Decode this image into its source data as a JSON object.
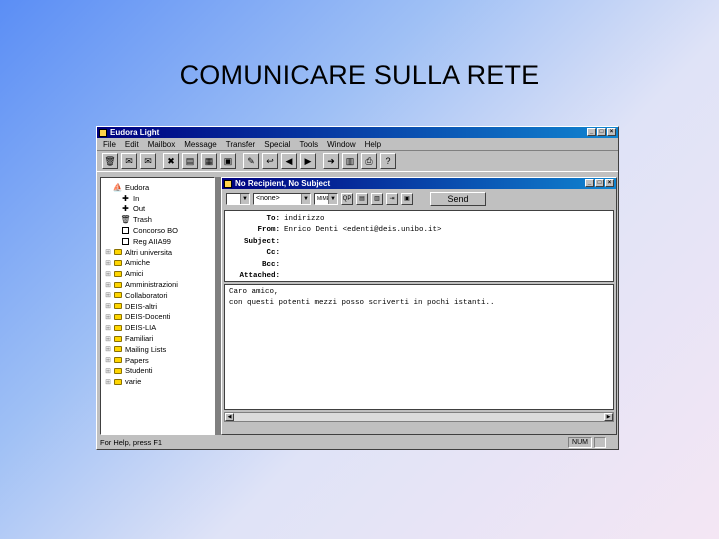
{
  "slide": {
    "title": "COMUNICARE SULLA RETE"
  },
  "app": {
    "title": "Eudora Light",
    "menu": [
      "File",
      "Edit",
      "Mailbox",
      "Message",
      "Transfer",
      "Special",
      "Tools",
      "Window",
      "Help"
    ],
    "status": "For Help, press F1",
    "status_num": "NUM"
  },
  "tree": {
    "items": [
      {
        "label": "Eudora",
        "lead": "",
        "icon": "eudora-icon"
      },
      {
        "label": "In",
        "lead": "",
        "icon": "in-box-icon"
      },
      {
        "label": "Out",
        "lead": "",
        "icon": "out-box-icon"
      },
      {
        "label": "Trash",
        "lead": "",
        "icon": "trash-icon"
      },
      {
        "label": "Concorso BO",
        "lead": "",
        "icon": "mailbox-icon"
      },
      {
        "label": "Reg AIIA99",
        "lead": "",
        "icon": "mailbox-icon"
      },
      {
        "label": "Altri universita",
        "lead": "⊞",
        "icon": "folder-icon"
      },
      {
        "label": "Amiche",
        "lead": "⊞",
        "icon": "folder-icon"
      },
      {
        "label": "Amici",
        "lead": "⊞",
        "icon": "folder-icon"
      },
      {
        "label": "Amministrazioni",
        "lead": "⊞",
        "icon": "folder-icon"
      },
      {
        "label": "Collaboratori",
        "lead": "⊞",
        "icon": "folder-icon"
      },
      {
        "label": "DEIS-altri",
        "lead": "⊞",
        "icon": "folder-icon"
      },
      {
        "label": "DEIS-Docenti",
        "lead": "⊞",
        "icon": "folder-icon"
      },
      {
        "label": "DEIS-LIA",
        "lead": "⊞",
        "icon": "folder-icon"
      },
      {
        "label": "Familiari",
        "lead": "⊞",
        "icon": "folder-icon"
      },
      {
        "label": "Mailing Lists",
        "lead": "⊞",
        "icon": "folder-icon"
      },
      {
        "label": "Papers",
        "lead": "⊞",
        "icon": "folder-icon"
      },
      {
        "label": "Studenti",
        "lead": "⊞",
        "icon": "folder-icon"
      },
      {
        "label": "varie",
        "lead": "⊞",
        "icon": "folder-icon"
      }
    ]
  },
  "message": {
    "window_title": "No Recipient, No Subject",
    "priority_select": "",
    "signature_select": "<none>",
    "encoding_select": "MIME",
    "send_label": "Send",
    "headers": [
      {
        "label": "To:",
        "value": "indirizzo"
      },
      {
        "label": "From:",
        "value": "Enrico Denti <edenti@deis.unibo.it>"
      },
      {
        "label": "Subject:",
        "value": ""
      },
      {
        "label": "Cc:",
        "value": ""
      },
      {
        "label": "Bcc:",
        "value": ""
      },
      {
        "label": "Attached:",
        "value": ""
      }
    ],
    "body_lines": [
      "Caro amico,",
      "con questi potenti mezzi posso scriverti in pochi istanti.."
    ]
  }
}
